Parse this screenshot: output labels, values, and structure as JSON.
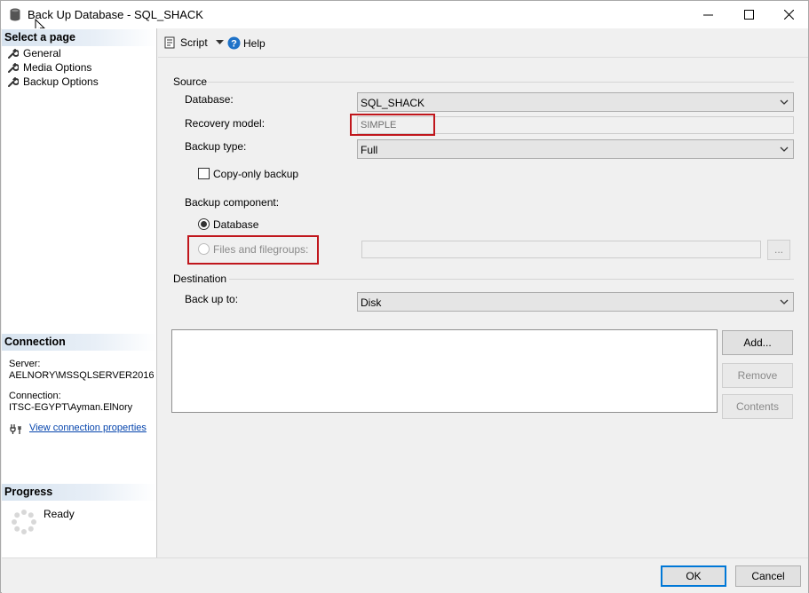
{
  "window": {
    "title": "Back Up Database - SQL_SHACK",
    "controls": [
      "minimize",
      "maximize",
      "close"
    ]
  },
  "left_pane": {
    "select_page": {
      "header": "Select a page",
      "items": [
        {
          "label": "General",
          "icon": "wrench-icon"
        },
        {
          "label": "Media Options",
          "icon": "wrench-icon"
        },
        {
          "label": "Backup Options",
          "icon": "wrench-icon"
        }
      ]
    },
    "connection": {
      "header": "Connection",
      "server_label": "Server:",
      "server_value": "AELNORY\\MSSQLSERVER2016",
      "connection_label": "Connection:",
      "connection_value": "ITSC-EGYPT\\Ayman.ElNory",
      "view_link": "View connection properties"
    },
    "progress": {
      "header": "Progress",
      "status": "Ready"
    }
  },
  "toolbar": {
    "script_label": "Script",
    "help_label": "Help"
  },
  "source": {
    "group_label": "Source",
    "database_label": "Database:",
    "database_value": "SQL_SHACK",
    "recovery_label": "Recovery model:",
    "recovery_value": "SIMPLE",
    "backup_type_label": "Backup type:",
    "backup_type_value": "Full",
    "copy_only_label": "Copy-only backup",
    "copy_only_checked": false,
    "component_label": "Backup component:",
    "component_options": [
      {
        "label": "Database",
        "selected": true,
        "enabled": true
      },
      {
        "label": "Files and filegroups:",
        "selected": false,
        "enabled": false
      }
    ],
    "browse_label": "..."
  },
  "destination": {
    "group_label": "Destination",
    "back_up_to_label": "Back up to:",
    "back_up_to_value": "Disk",
    "destinations": [],
    "add_label": "Add...",
    "remove_label": "Remove",
    "contents_label": "Contents"
  },
  "footer": {
    "ok_label": "OK",
    "cancel_label": "Cancel"
  },
  "colors": {
    "highlight_border": "#c0161c",
    "link": "#0645ad",
    "default_button_border": "#0078d7"
  }
}
